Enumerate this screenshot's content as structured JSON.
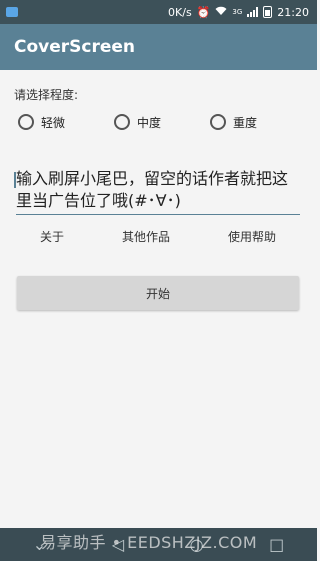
{
  "status_bar": {
    "net_speed": "0K/s",
    "time": "21:20",
    "network": "3G",
    "icons": [
      "notification-icon",
      "alarm-icon",
      "wifi-icon",
      "signal-icon",
      "battery-icon"
    ]
  },
  "app_bar": {
    "title": "CoverScreen"
  },
  "degree": {
    "label": "请选择程度:",
    "options": [
      {
        "label": "轻微",
        "selected": false
      },
      {
        "label": "中度",
        "selected": false
      },
      {
        "label": "重度",
        "selected": false
      }
    ]
  },
  "input": {
    "value": "输入刷屏小尾巴，留空的话作者就把这里当广告位了哦(#･∀･)"
  },
  "links": {
    "about": "关于",
    "other_works": "其他作品",
    "help": "使用帮助"
  },
  "start_button": {
    "label": "开始"
  },
  "nav_bar": {
    "icons": [
      "chevron-down-icon",
      "back-icon",
      "home-icon",
      "recents-icon"
    ]
  },
  "watermark": {
    "text": "易享助手 • EEDSHZJZ.COM"
  },
  "colors": {
    "status_bar": "#3d5159",
    "app_bar": "#5a8195",
    "background": "#f4f4f4",
    "button": "#d6d6d6",
    "nav_bar": "#3a4c54"
  }
}
